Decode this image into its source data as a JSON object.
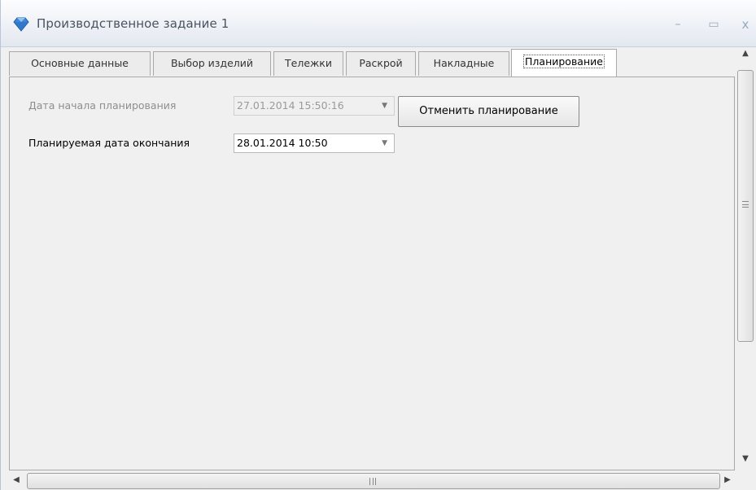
{
  "window": {
    "title": "Производственное задание 1",
    "minimize_glyph": "–",
    "maximize_glyph": "▭",
    "close_glyph": "x"
  },
  "tabs": [
    {
      "label": "Основные данные",
      "active": false
    },
    {
      "label": "Выбор изделий",
      "active": false
    },
    {
      "label": "Тележки",
      "active": false
    },
    {
      "label": "Раскрой",
      "active": false
    },
    {
      "label": "Накладные",
      "active": false
    },
    {
      "label": "Планирование",
      "active": true
    }
  ],
  "planning": {
    "start_label": "Дата начала планирования",
    "start_value": "27.01.2014 15:50:16",
    "end_label": "Планируемая дата окончания",
    "end_value": "28.01.2014 10:50",
    "cancel_button": "Отменить планирование"
  },
  "icons": {
    "app": "diamond-icon",
    "dropdown": "chevron-down-icon"
  },
  "colors": {
    "disabled_text": "#8e8e8e",
    "panel_bg": "#f0f0f0"
  }
}
